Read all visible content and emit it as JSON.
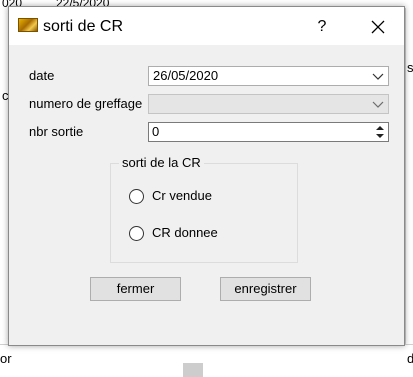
{
  "background": {
    "top_cell_1": "020",
    "top_cell_2": "22/5/2020",
    "left_fragment": "c",
    "left_bottom_fragment": "or",
    "right_fragment": "s",
    "right_bottom_fragment": "d"
  },
  "dialog": {
    "title": "sorti de CR",
    "help_label": "?",
    "app_icon": "folder-photo-icon",
    "close_icon": "close-icon"
  },
  "form": {
    "date_label": "date",
    "date_value": "26/05/2020",
    "greffage_label": "numero de greffage",
    "greffage_value": "",
    "nbr_sortie_label": "nbr sortie",
    "nbr_sortie_value": "0"
  },
  "group": {
    "title": "sorti de la CR",
    "options": [
      {
        "label": "Cr vendue",
        "checked": false
      },
      {
        "label": "CR donnee",
        "checked": false
      }
    ]
  },
  "buttons": {
    "close_label": "fermer",
    "save_label": "enregistrer"
  }
}
